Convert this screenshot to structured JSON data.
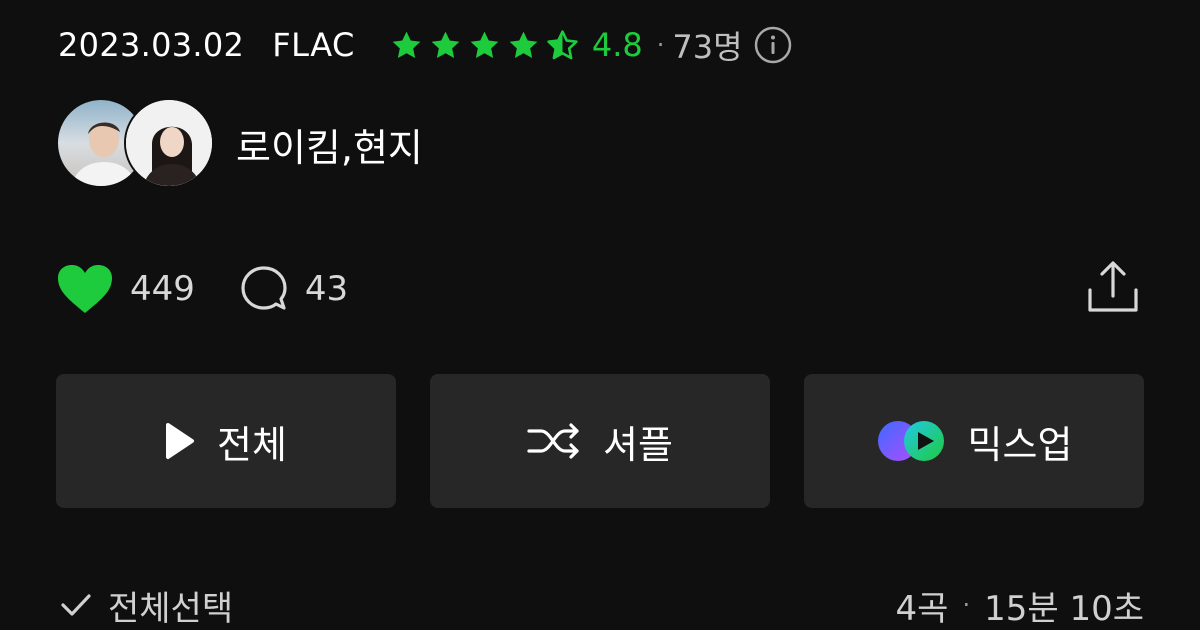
{
  "album_meta": {
    "release_date": "2023.03.02",
    "format": "FLAC",
    "rating": "4.8",
    "rating_count": "73명",
    "star_count": 4.5,
    "accent_color": "#1ecb3d"
  },
  "artists": {
    "names": "로이킴,현지"
  },
  "social": {
    "likes": "449",
    "comments": "43"
  },
  "actions": {
    "play_all": "전체",
    "shuffle": "셔플",
    "mixup": "믹스업"
  },
  "list_header": {
    "select_all": "전체선택",
    "track_count": "4곡",
    "duration": "15분 10초"
  },
  "icons": [
    "star-icon",
    "info-icon",
    "heart-icon",
    "comment-icon",
    "share-icon",
    "play-icon",
    "shuffle-icon",
    "mixup-icon",
    "check-icon"
  ]
}
